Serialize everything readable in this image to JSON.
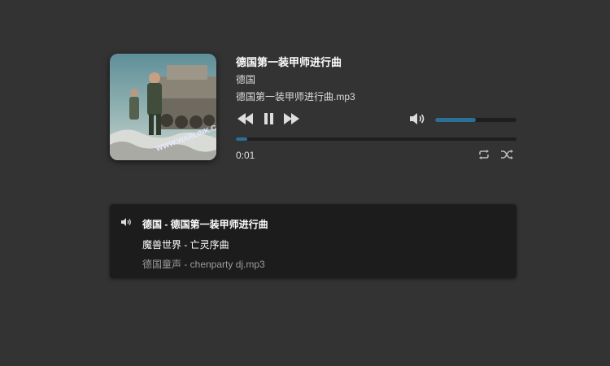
{
  "player": {
    "cover_alt": "album cover - soldiers with tank",
    "cover_watermark": "WWW.WARLINK.COM",
    "title": "德国第一装甲师进行曲",
    "artist": "德国",
    "file": "德国第一装甲师进行曲.mp3",
    "current_time": "0:01",
    "progress_percent": 4,
    "volume_percent": 50,
    "accent_color": "#2b6f98"
  },
  "controls": {
    "prev_icon": "rewind-icon",
    "pause_icon": "pause-icon",
    "next_icon": "fast-forward-icon",
    "volume_icon": "volume-icon",
    "repeat_icon": "repeat-icon",
    "shuffle_icon": "shuffle-icon"
  },
  "playlist": {
    "items": [
      {
        "label": "德国 - 德国第一装甲师进行曲",
        "state": "playing"
      },
      {
        "label": "魔兽世界 - 亡灵序曲",
        "state": "normal"
      },
      {
        "label": "德国童声 - chenparty dj.mp3",
        "state": "dimmed"
      }
    ]
  }
}
